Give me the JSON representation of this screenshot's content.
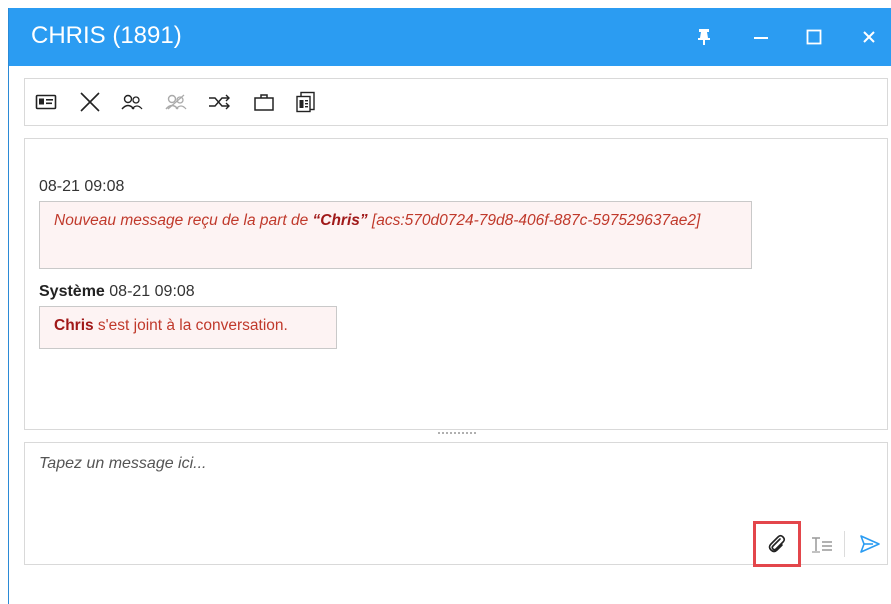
{
  "window": {
    "title": "CHRIS (1891)",
    "controls": [
      "pin-icon",
      "minimize-icon",
      "maximize-icon",
      "close-icon"
    ]
  },
  "toolbar": {
    "tools": [
      "contact-card-icon",
      "end-conversation-icon",
      "participants-icon",
      "remove-participant-icon",
      "transfer-icon",
      "briefcase-icon",
      "transcript-icon"
    ]
  },
  "messages": [
    {
      "sender": "",
      "timestamp": "08-21 09:08",
      "pre": "Nouveau message reçu de la part de ",
      "name": "“Chris”",
      "post": " [acs:570d0724-79d8-406f-887c-597529637ae2]"
    },
    {
      "sender": "Système",
      "timestamp": "08-21 09:08",
      "name": "Chris",
      "post": " s'est joint à la conversation."
    }
  ],
  "compose": {
    "placeholder": "Tapez un message ici...",
    "actions": [
      "attach-icon",
      "text-format-icon",
      "send-icon"
    ]
  },
  "colors": {
    "titlebar": "#2b9cf2",
    "message_text": "#c0392b",
    "bubble_bg": "#fdf3f3",
    "highlight": "#e3464b",
    "send": "#2b9cf2"
  }
}
